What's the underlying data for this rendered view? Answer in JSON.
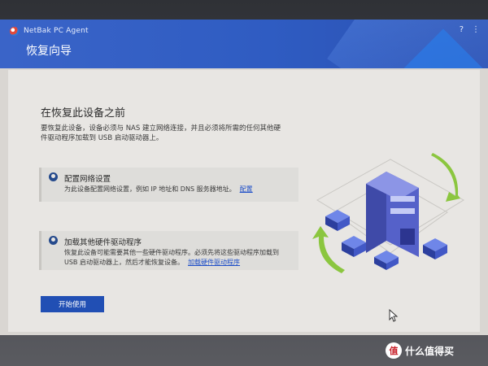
{
  "app": {
    "title": "NetBak PC Agent",
    "window_controls": [
      "?",
      "⋮"
    ],
    "page_title": "恢复向导"
  },
  "main": {
    "section_title": "在恢复此设备之前",
    "intro": "要恢复此设备，设备必须与 NAS 建立网络连接，并且必须将所需的任何其他硬件驱动程序加载到 USB 启动驱动器上。",
    "cards": [
      {
        "title": "配置网络设置",
        "text": "为此设备配置网络设置，例如 IP 地址和 DNS 服务器地址。",
        "link": "配置"
      },
      {
        "title": "加载其他硬件驱动程序",
        "text": "恢复此设备可能需要其他一些硬件驱动程序。必须先将这些驱动程序加载到 USB 启动驱动器上，然后才能恢复设备。",
        "link": "加载硬件驱动程序"
      }
    ],
    "start_button": "开始使用"
  },
  "watermark": {
    "logo_char": "值",
    "text": "什么值得买"
  },
  "colors": {
    "header_blue": "#2f5cc2",
    "button_blue": "#214fb4",
    "link_blue": "#1f4fc8",
    "arrow_green": "#8bc63f",
    "content_bg": "#e8e6e3"
  },
  "icons": [
    "app-logo-icon",
    "info-pin-icon",
    "mouse-cursor-icon",
    "server-illustration"
  ]
}
